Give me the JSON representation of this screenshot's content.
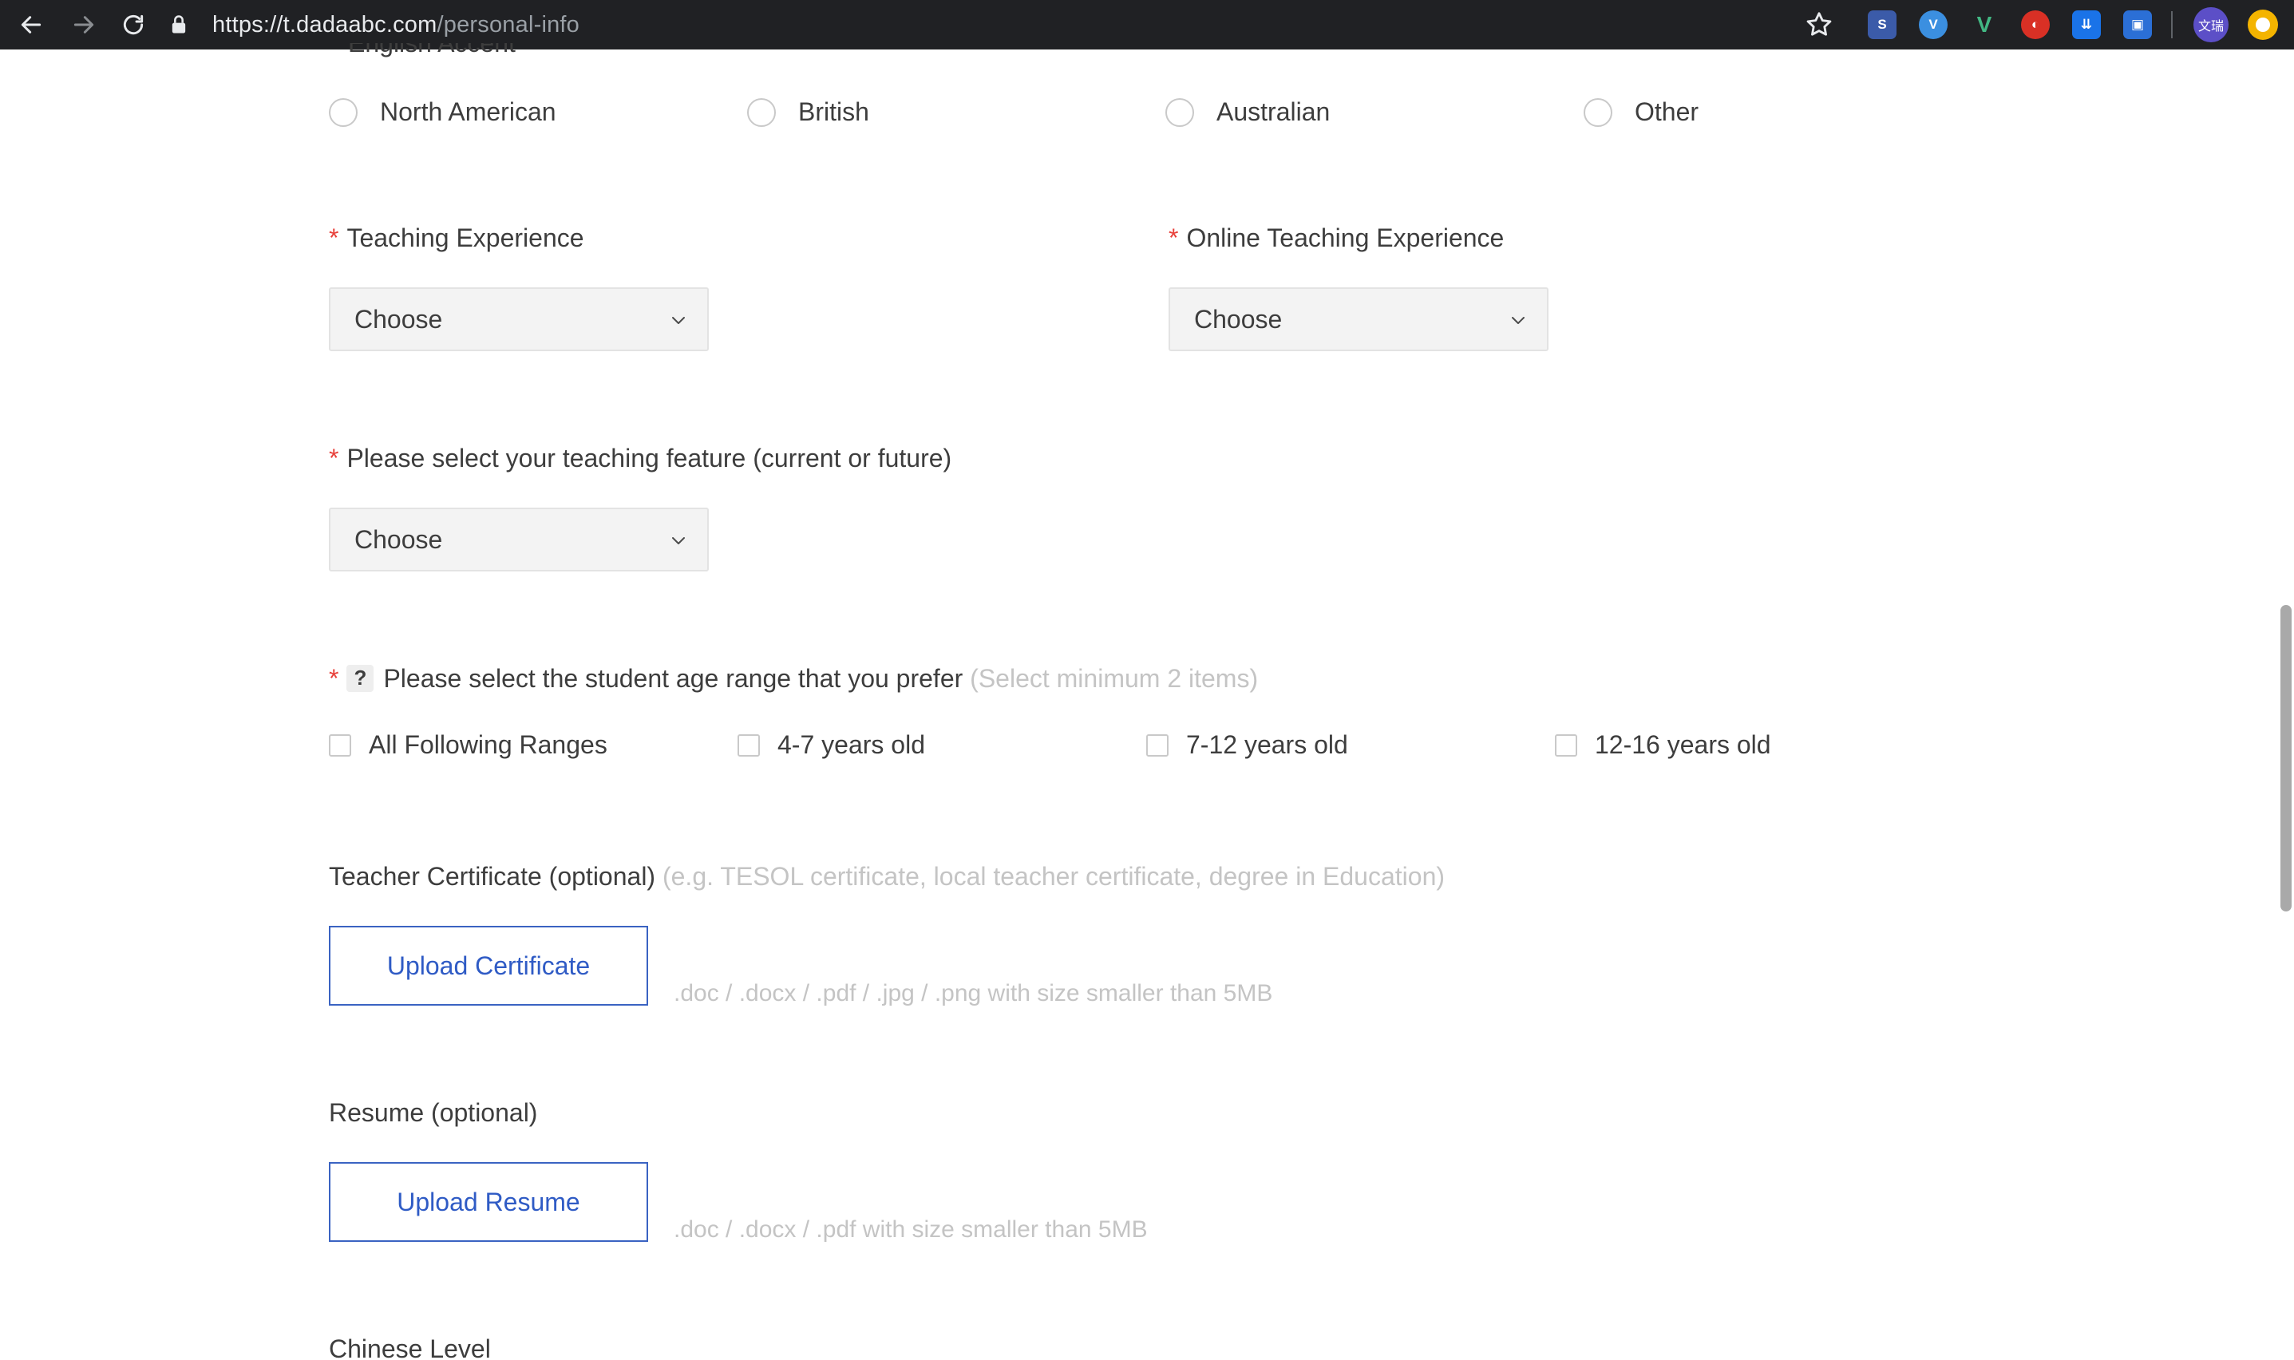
{
  "browser": {
    "url_host": "https://t.dadaabc.com",
    "url_path": "/personal-info",
    "profile_label": "文瑞"
  },
  "accent": {
    "section_title": "English Accent",
    "options": [
      "North American",
      "British",
      "Australian",
      "Other"
    ]
  },
  "teaching_experience": {
    "required_mark": "*",
    "label": "Teaching Experience",
    "select_value": "Choose"
  },
  "online_teaching_experience": {
    "required_mark": "*",
    "label": "Online Teaching Experience",
    "select_value": "Choose"
  },
  "teaching_feature": {
    "required_mark": "*",
    "label": "Please select your teaching feature (current or future)",
    "select_value": "Choose"
  },
  "age_range": {
    "required_mark": "*",
    "help_glyph": "?",
    "label": "Please select the student age range that you prefer",
    "hint": "(Select minimum 2 items)",
    "options": [
      "All Following Ranges",
      "4-7 years old",
      "7-12 years old",
      "12-16 years old"
    ]
  },
  "certificate": {
    "label": "Teacher Certificate (optional)",
    "hint": "(e.g. TESOL certificate, local teacher certificate, degree in Education)",
    "button": "Upload Certificate",
    "file_hint": ".doc / .docx / .pdf / .jpg / .png with size smaller than 5MB"
  },
  "resume": {
    "label": "Resume (optional)",
    "button": "Upload Resume",
    "file_hint": ".doc / .docx / .pdf with size smaller than 5MB"
  },
  "chinese_level": {
    "label": "Chinese Level"
  },
  "colors": {
    "required": "#e8413b",
    "link_blue": "#2f5bc5",
    "hint_gray": "#c4c4c4"
  }
}
